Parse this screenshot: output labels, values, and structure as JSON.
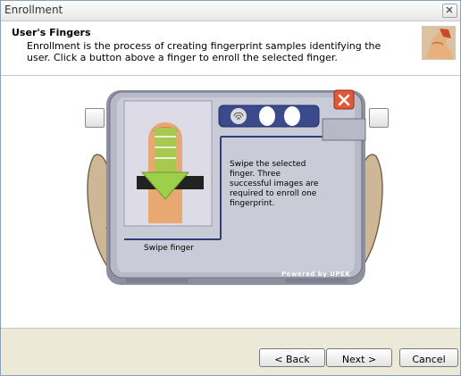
{
  "window": {
    "title": "Enrollment"
  },
  "header": {
    "title": "User's Fingers",
    "description": "Enrollment is the process of creating fingerprint samples identifying the user. Click a button above a finger to enroll the selected finger."
  },
  "device": {
    "instruction": "Swipe the selected finger. Three successful images are required to enroll one fingerprint.",
    "image_caption": "Swipe finger",
    "brand": "Powered by UPEK",
    "progress_dots_total": 3,
    "progress_dots_done": 0
  },
  "footer": {
    "back_label": "< Back",
    "next_label": "Next >",
    "cancel_label": "Cancel"
  },
  "colors": {
    "panel_blue": "#2e3f7a",
    "device_grey": "#a7a9b8",
    "close_red": "#e05a3a",
    "arrow_green": "#9ccf4a"
  },
  "icons": [
    "close-icon",
    "fingerprint-icon",
    "swipe-arrow-icon",
    "hand-icon"
  ]
}
